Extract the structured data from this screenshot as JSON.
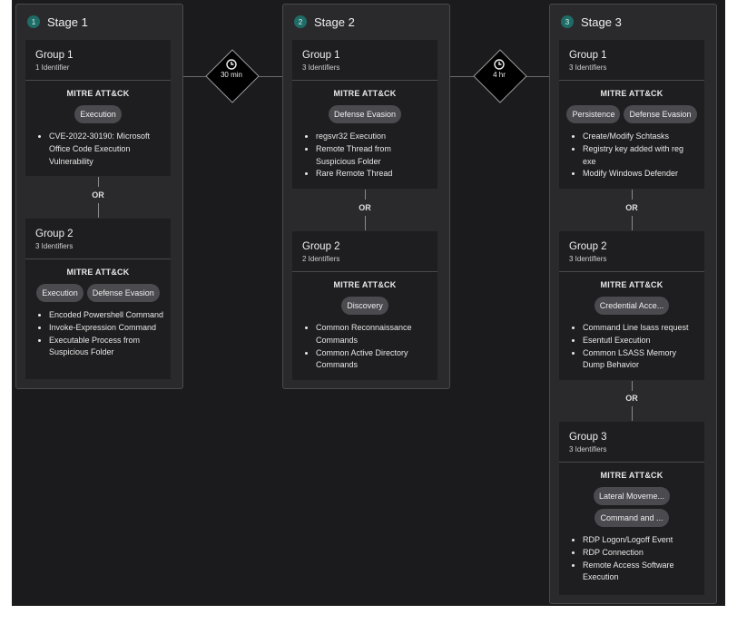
{
  "stages": [
    {
      "num": "1",
      "title": "Stage 1",
      "groups": [
        {
          "title": "Group 1",
          "sub": "1 Identifier",
          "mitre": "MITRE ATT&CK",
          "tags": [
            "Execution"
          ],
          "items": [
            "CVE-2022-30190: Microsoft Office Code Execution Vulnerability"
          ]
        },
        {
          "title": "Group 2",
          "sub": "3 Identifiers",
          "mitre": "MITRE ATT&CK",
          "tags": [
            "Execution",
            "Defense Evasion"
          ],
          "items": [
            "Encoded Powershell Command",
            "Invoke-Expression Command",
            "Executable Process from Suspicious Folder"
          ]
        }
      ],
      "or_labels": [
        "OR"
      ]
    },
    {
      "num": "2",
      "title": "Stage 2",
      "groups": [
        {
          "title": "Group 1",
          "sub": "3 Identifiers",
          "mitre": "MITRE ATT&CK",
          "tags": [
            "Defense Evasion"
          ],
          "items": [
            "regsvr32 Execution",
            "Remote Thread from Suspicious Folder",
            "Rare Remote Thread"
          ]
        },
        {
          "title": "Group 2",
          "sub": "2 Identifiers",
          "mitre": "MITRE ATT&CK",
          "tags": [
            "Discovery"
          ],
          "items": [
            "Common Reconnaissance Commands",
            "Common Active Directory Commands"
          ]
        }
      ],
      "or_labels": [
        "OR"
      ]
    },
    {
      "num": "3",
      "title": "Stage 3",
      "groups": [
        {
          "title": "Group 1",
          "sub": "3 Identifiers",
          "mitre": "MITRE ATT&CK",
          "tags": [
            "Persistence",
            "Defense Evasion"
          ],
          "items": [
            "Create/Modify Schtasks",
            "Registry key added with reg exe",
            "Modify Windows Defender"
          ]
        },
        {
          "title": "Group 2",
          "sub": "3 Identifiers",
          "mitre": "MITRE ATT&CK",
          "tags": [
            "Credential Acce..."
          ],
          "items": [
            "Command Line lsass request",
            "Esentutl Execution",
            "Common LSASS Memory Dump Behavior"
          ]
        },
        {
          "title": "Group 3",
          "sub": "3 Identifiers",
          "mitre": "MITRE ATT&CK",
          "tags": [
            "Lateral Moveme...",
            "Command and ..."
          ],
          "items": [
            "RDP Logon/Logoff Event",
            "RDP Connection",
            "Remote Access Software Execution"
          ]
        }
      ],
      "or_labels": [
        "OR",
        "OR"
      ]
    }
  ],
  "waits": [
    "30 min",
    "4 hr"
  ],
  "icons": {
    "stage_number": "number-badge-icon",
    "wait": "clock-icon",
    "list": "bullet-icon"
  },
  "colors": {
    "background": "#1b1b1d",
    "stage_bg": "#2a2a2d",
    "group_bg": "#1e1e20",
    "tag_bg": "#4a4a4f",
    "badge": "#1f6b66",
    "diamond": "#000000"
  }
}
